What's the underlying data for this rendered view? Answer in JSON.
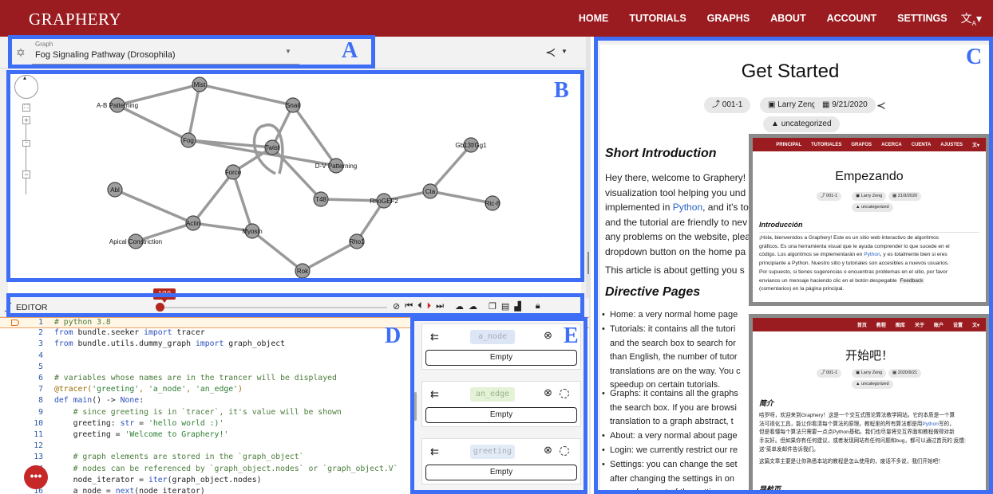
{
  "nav": {
    "brand": "GRAPHERY",
    "links": [
      "HOME",
      "TUTORIALS",
      "GRAPHS",
      "ABOUT",
      "ACCOUNT",
      "SETTINGS"
    ],
    "lang_icon": "translate-icon"
  },
  "graph_select": {
    "caption": "Graph",
    "value": "Fog Signaling Pathway (Drosophila)"
  },
  "graph": {
    "nodes": [
      "Mist",
      "A-B Patterning",
      "Snail",
      "Fog",
      "Twist",
      "D-V Patterning",
      "Gb13f/Gg1",
      "Force",
      "Abl",
      "T48",
      "RhoGEF2",
      "Cta",
      "Ric-8",
      "Actin",
      "Myosin",
      "Apical Constriction",
      "Rho1",
      "Rok"
    ]
  },
  "editor": {
    "title": "EDITOR",
    "step_badge": "1/10",
    "lines": [
      {
        "n": "1",
        "parts": [
          [
            "c-com",
            "# python 3.8"
          ]
        ]
      },
      {
        "n": "2",
        "parts": [
          [
            "c-kw",
            "from"
          ],
          [
            "c-plain",
            " bundle.seeker "
          ],
          [
            "c-kw",
            "import"
          ],
          [
            "c-plain",
            " tracer"
          ]
        ]
      },
      {
        "n": "3",
        "parts": [
          [
            "c-kw",
            "from"
          ],
          [
            "c-plain",
            " bundle.utils.dummy_graph "
          ],
          [
            "c-kw",
            "import"
          ],
          [
            "c-plain",
            " graph_object"
          ]
        ]
      },
      {
        "n": "4",
        "parts": []
      },
      {
        "n": "5",
        "parts": []
      },
      {
        "n": "6",
        "parts": [
          [
            "c-com",
            "# variables whose names are in the trancer will be displayed"
          ]
        ]
      },
      {
        "n": "7",
        "parts": [
          [
            "c-dec",
            "@tracer("
          ],
          [
            "c-str",
            "'greeting'"
          ],
          [
            "c-dec",
            ", "
          ],
          [
            "c-str",
            "'a_node'"
          ],
          [
            "c-dec",
            ", "
          ],
          [
            "c-str",
            "'an_edge'"
          ],
          [
            "c-dec",
            ")"
          ]
        ]
      },
      {
        "n": "8",
        "parts": [
          [
            "c-kw",
            "def"
          ],
          [
            "c-fn",
            " main"
          ],
          [
            "c-plain",
            "() -> "
          ],
          [
            "c-kw",
            "None"
          ],
          [
            "c-plain",
            ":"
          ]
        ]
      },
      {
        "n": "9",
        "parts": [
          [
            "c-com",
            "    # since greeting is in `tracer`, it's value will be shown"
          ]
        ]
      },
      {
        "n": "10",
        "parts": [
          [
            "c-plain",
            "    greeting: "
          ],
          [
            "c-kw",
            "str"
          ],
          [
            "c-plain",
            " = "
          ],
          [
            "c-str",
            "'hello world :)'"
          ]
        ]
      },
      {
        "n": "11",
        "parts": [
          [
            "c-plain",
            "    greeting = "
          ],
          [
            "c-str",
            "'Welcome to Graphery!'"
          ]
        ]
      },
      {
        "n": "12",
        "parts": []
      },
      {
        "n": "13",
        "parts": [
          [
            "c-com",
            "    # graph elements are stored in the `graph_object`"
          ]
        ]
      },
      {
        "n": "14",
        "parts": [
          [
            "c-com",
            "    # nodes can be referenced by `graph_object.nodes` or `graph_object.V`"
          ]
        ]
      },
      {
        "n": "15",
        "parts": [
          [
            "c-plain",
            "    node_iterator = "
          ],
          [
            "c-fn",
            "iter"
          ],
          [
            "c-plain",
            "(graph_object.nodes)"
          ]
        ]
      },
      {
        "n": "16",
        "parts": [
          [
            "c-plain",
            "    a_node = "
          ],
          [
            "c-fn",
            "next"
          ],
          [
            "c-plain",
            "(node_iterator)"
          ]
        ]
      }
    ]
  },
  "variables": [
    {
      "name": "a_node",
      "value": "Empty",
      "color": "#dde6f5"
    },
    {
      "name": "an_edge",
      "value": "Empty",
      "color": "#e4f2d8"
    },
    {
      "name": "greeting",
      "value": "Empty",
      "color": "#e2ecf7"
    }
  ],
  "article": {
    "title": "Get Started",
    "chips": {
      "version": "001-1",
      "author": "Larry Zeng",
      "date": "9/21/2020",
      "category": "uncategorized"
    },
    "h_intro": "Short Introduction",
    "intro_lines": [
      "Hey there, welcome to Graphery!",
      "visualization tool helping you und",
      "implemented in ",
      "and the tutorial are friendly to nev",
      "any problems on the website, plea",
      "dropdown button on the home pa"
    ],
    "python": "Python",
    "after": "and it's to",
    "about_line": "This article is about getting you s",
    "h_directive": "Directive Pages",
    "bullets": [
      [
        "Home: a very normal home page"
      ],
      [
        "Tutorials: it contains all the tutori",
        "and the search box to search for",
        "than English, the number of tutor",
        "translations are on the way. You c",
        "speedup on certain tutorials."
      ],
      [
        "Graphs: it contains all the graphs",
        "the search box. If you are browsi",
        "translation to a graph abstract, t"
      ],
      [
        "About: a very normal about page"
      ],
      [
        "Login: we currently restrict our re"
      ],
      [
        "Settings: you can change the set",
        "after changing the settings in on",
        "pages for most of the settings."
      ]
    ],
    "side_text": "er"
  },
  "overlay_es": {
    "nav": [
      "PRINCIPAL",
      "TUTORIALES",
      "GRAFOS",
      "ACERCA",
      "CUENTA",
      "AJUSTES"
    ],
    "title": "Empezando",
    "chips": {
      "version": "001-1",
      "author": "Larry Zeng",
      "date": "21/9/2020",
      "category": "uncategorized"
    },
    "h": "Introducción",
    "lines": [
      "¡Hola, bienvenidos a Graphery! Este es un sitio web interactivo de algoritmos",
      "gráficos. Es una herramienta visual que le ayuda comprender lo que sucede en el",
      "código. Los algoritmos se implementarán en ",
      "principiante a Python. Nuestro sitio y tutoriales son accesibles a nuevos usuarios.",
      "Por supuesto, si tienes sugerencias o encuentras problemas en el sitio, por favor",
      "envianos un mensaje haciendo clic en el botón despegable ",
      "(comentarios) en la página principal."
    ],
    "python": "Python",
    "line3_tail": ", y es totalmente bien si eres",
    "feedback": "Feedback"
  },
  "overlay_zh": {
    "nav": [
      "首页",
      "教程",
      "图库",
      "关于",
      "账户",
      "设置"
    ],
    "title": "开始吧！",
    "chips": {
      "version": "001-1",
      "author": "Larry Zeng",
      "date": "2020/9/21",
      "category": "uncategorized"
    },
    "h": "简介",
    "lines": [
      "哈罗呀，欢迎来到Graphery！这是一个交互式图论算法教学网站。它的本质是一个算",
      "法可视化工具，能让你看清每个算法的原理。教程里的所有算法都是用",
      "但是看懂每个算法只需要一点点Python基础。我们也尽量将交互界面和教程做得对新",
      "手友好。但如果你有任何建议，或者发现网站有任何问题和bug，都可以通过首页的",
      "送”菜单发邮件告诉我们。",
      "这篇文章主要是让你熟悉本站的教程是怎么使用的，废话不多说，我们开始吧！"
    ],
    "python": "Python",
    "line2_tail": "写的，",
    "feedback": "反馈",
    "h2": "导航页"
  },
  "labels": [
    "A",
    "B",
    "C",
    "D",
    "E"
  ]
}
